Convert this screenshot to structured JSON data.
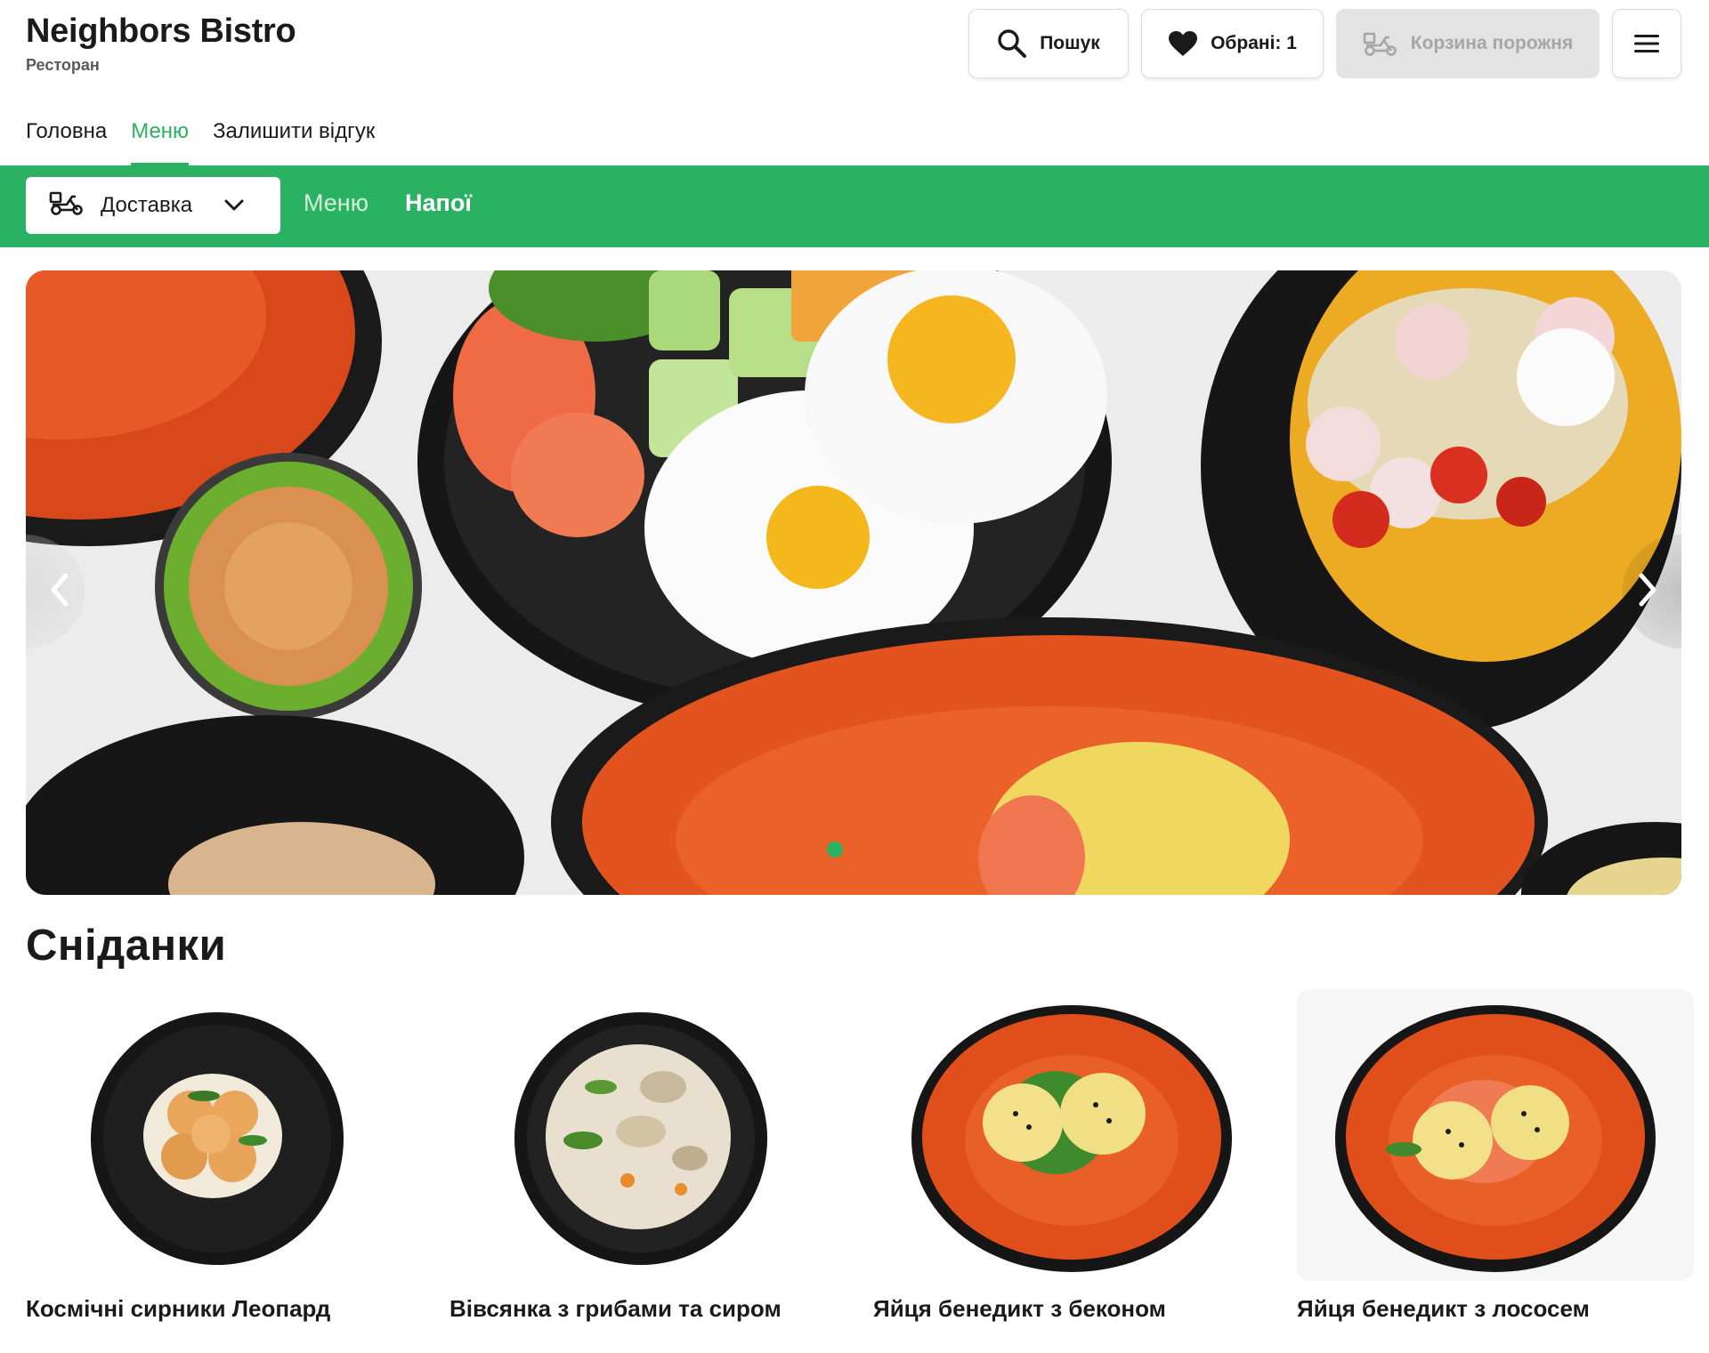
{
  "brand": {
    "name": "Neighbors Bistro",
    "subtitle": "Ресторан"
  },
  "header_buttons": {
    "search_label": "Пошук",
    "favorites_label": "Обрані: 1",
    "cart_label": "Корзина порожня"
  },
  "nav": {
    "items": [
      {
        "label": "Головна",
        "active": false
      },
      {
        "label": "Меню",
        "active": true
      },
      {
        "label": "Залишити відгук",
        "active": false
      }
    ]
  },
  "category_bar": {
    "delivery_select": "Доставка",
    "links": [
      "Меню",
      "Напої"
    ]
  },
  "hero": {
    "slide_count": 1,
    "active_slide": 1
  },
  "section": {
    "title": "Сніданки",
    "items": [
      {
        "title": "Космічні сирники Леопард"
      },
      {
        "title": "Вівсянка з грибами та сиром"
      },
      {
        "title": "Яйця бенедикт з беконом"
      },
      {
        "title": "Яйця бенедикт з лососем"
      }
    ]
  },
  "colors": {
    "accent": "#2ab262",
    "text": "#1a1a1a",
    "muted": "#5a5a5a",
    "disabled_bg": "#e3e3e3",
    "disabled_text": "#a6a6a6"
  }
}
